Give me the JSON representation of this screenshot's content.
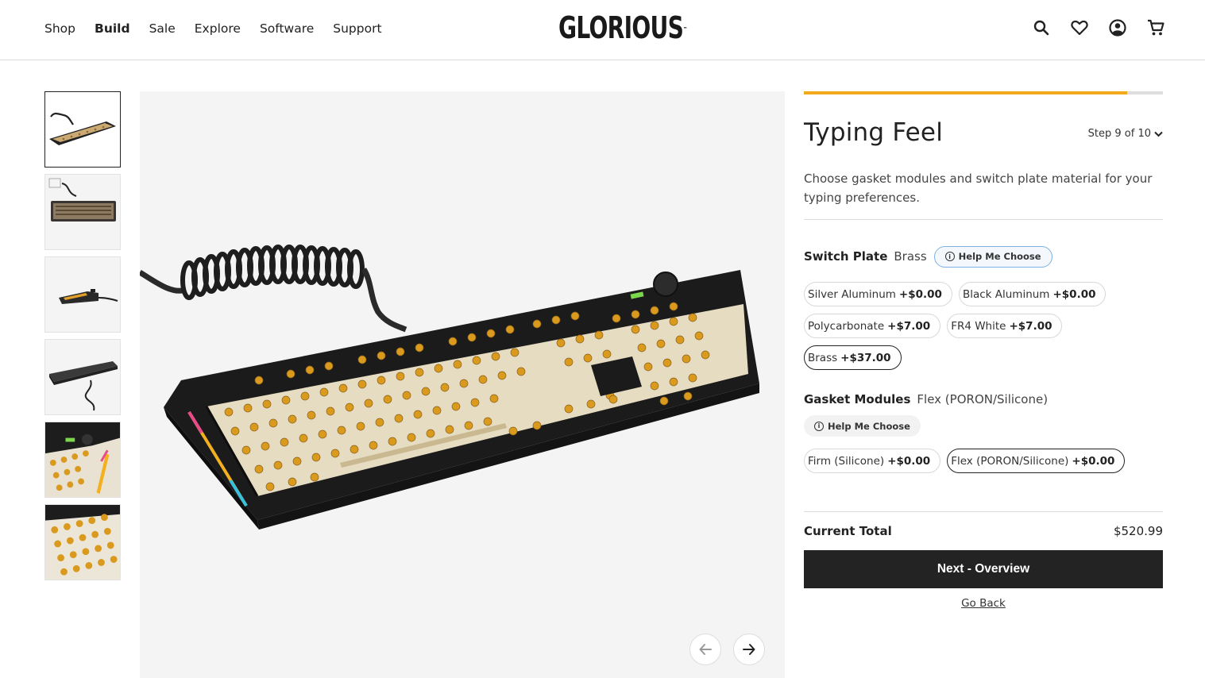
{
  "header": {
    "nav": [
      "Shop",
      "Build",
      "Sale",
      "Explore",
      "Software",
      "Support"
    ],
    "active_nav": "Build",
    "logo": "GLORIOUS",
    "logo_tm": "™",
    "icons": [
      "search-icon",
      "heart-icon",
      "account-icon",
      "cart-icon"
    ]
  },
  "gallery": {
    "thumbnail_count": 6,
    "selected_index": 0
  },
  "panel": {
    "progress_fraction": 0.9,
    "title": "Typing Feel",
    "step": "Step 9 of 10",
    "description": "Choose gasket modules and switch plate material for your typing preferences.",
    "switch_plate": {
      "label": "Switch Plate",
      "selected": "Brass",
      "help": "Help Me Choose",
      "options": [
        {
          "name": "Silver Aluminum",
          "price": "+$0.00"
        },
        {
          "name": "Black Aluminum",
          "price": "+$0.00"
        },
        {
          "name": "Polycarbonate",
          "price": "+$7.00"
        },
        {
          "name": "FR4 White",
          "price": "+$7.00"
        },
        {
          "name": "Brass",
          "price": "+$37.00"
        }
      ]
    },
    "gasket_modules": {
      "label": "Gasket Modules",
      "selected": "Flex (PORON/Silicone)",
      "help": "Help Me Choose",
      "options": [
        {
          "name": "Firm (Silicone)",
          "price": "+$0.00"
        },
        {
          "name": "Flex (PORON/Silicone)",
          "price": "+$0.00"
        }
      ]
    },
    "total_label": "Current Total",
    "total_value": "$520.99",
    "next_button": "Next - Overview",
    "go_back": "Go Back"
  },
  "colors": {
    "accent": "#f2a91c",
    "button_dark": "#232323",
    "help_border": "#7fb0e0"
  }
}
